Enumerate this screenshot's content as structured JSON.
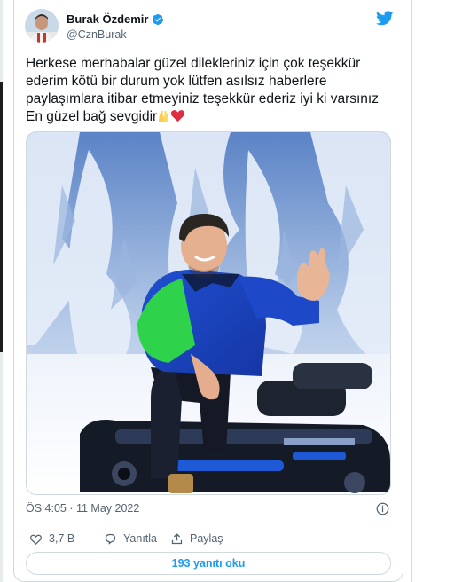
{
  "tweet": {
    "author": {
      "name": "Burak Özdemir",
      "handle": "@CznBurak",
      "verified": true,
      "avatar_icon": "avatar-photo"
    },
    "brand_icon": "twitter-bird-icon",
    "text_lines": [
      "Herkese merhabalar güzel dilekleriniz için çok teşekkür",
      "ederim kötü bir durum yok lütfen asılsız haberlere",
      "paylaşımlara itibar etmeyiniz teşekkür ederiz iyi ki varsınız",
      "En güzel bağ sevgidir"
    ],
    "emojis": [
      "praying-hands-emoji",
      "red-heart-emoji"
    ],
    "timestamp": "ÖS 4:05 · 11 May 2022",
    "actions": {
      "like_count": "3,7 B",
      "reply_label": "Yanıtla",
      "share_label": "Paylaş"
    },
    "read_replies_label": "193 yanıtı oku"
  },
  "colors": {
    "accent": "#1d9bf0",
    "heart": "#e0245e",
    "text": "#0f1419",
    "muted": "#536471",
    "border": "#cfd9de"
  }
}
